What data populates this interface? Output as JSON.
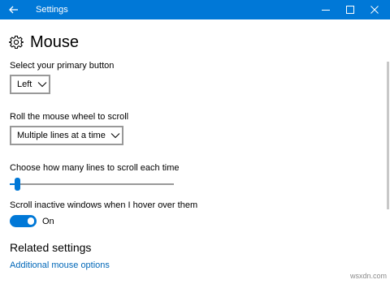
{
  "window": {
    "title": "Settings",
    "accent_color": "#0078d7",
    "controls": {
      "minimize": "minimize-icon",
      "maximize": "maximize-icon",
      "close": "close-icon"
    }
  },
  "page": {
    "icon": "gear-icon",
    "title": "Mouse"
  },
  "primary_button": {
    "label": "Select your primary button",
    "value": "Left"
  },
  "wheel_scroll": {
    "label": "Roll the mouse wheel to scroll",
    "value": "Multiple lines at a time"
  },
  "lines_to_scroll": {
    "label": "Choose how many lines to scroll each time",
    "level": 0.03
  },
  "inactive_scroll": {
    "label": "Scroll inactive windows when I hover over them",
    "state": "On",
    "enabled": true
  },
  "related": {
    "title": "Related settings",
    "link": "Additional mouse options"
  },
  "watermark": "wsxdn.com"
}
